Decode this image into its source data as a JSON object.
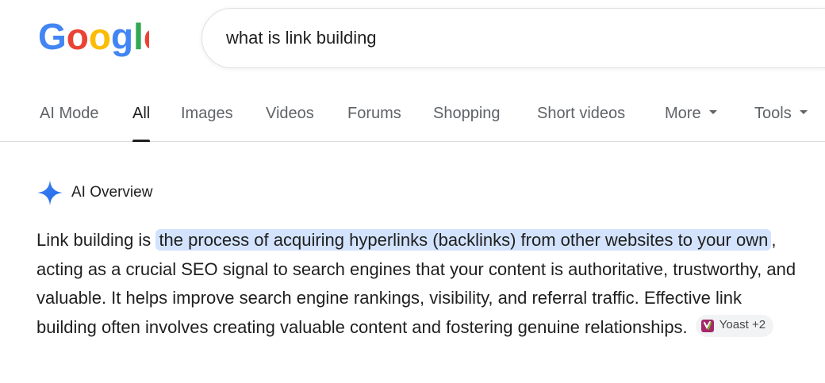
{
  "logo": {
    "letters": [
      "G",
      "o",
      "o",
      "g",
      "l",
      "e"
    ],
    "colors": [
      "#4285F4",
      "#EA4335",
      "#FBBC05",
      "#4285F4",
      "#34A853",
      "#EA4335"
    ]
  },
  "search": {
    "value": "what is link building"
  },
  "tabs": [
    {
      "label": "AI Mode"
    },
    {
      "label": "All",
      "active": true
    },
    {
      "label": "Images"
    },
    {
      "label": "Videos"
    },
    {
      "label": "Forums"
    },
    {
      "label": "Shopping"
    },
    {
      "label": "Short videos"
    },
    {
      "label": "More"
    },
    {
      "label": "Tools"
    }
  ],
  "ai_overview": {
    "title": "AI Overview",
    "text_before": "Link building is ",
    "highlight": "the process of acquiring hyperlinks (backlinks) from other websites to your own",
    "text_after": ", acting as a crucial SEO signal to search engines that your content is authoritative, trustworthy, and valuable. It helps improve search engine rankings, visibility, and referral traffic. Effective link building often involves creating valuable content and fostering genuine relationships.",
    "source_chip": "Yoast +2"
  },
  "colors": {
    "highlight_bg": "#d3e3fd",
    "tab_inactive": "#5f6368",
    "tab_active": "#1f1f1f",
    "spark": "#4285F4",
    "yoast": "#a4286a"
  }
}
